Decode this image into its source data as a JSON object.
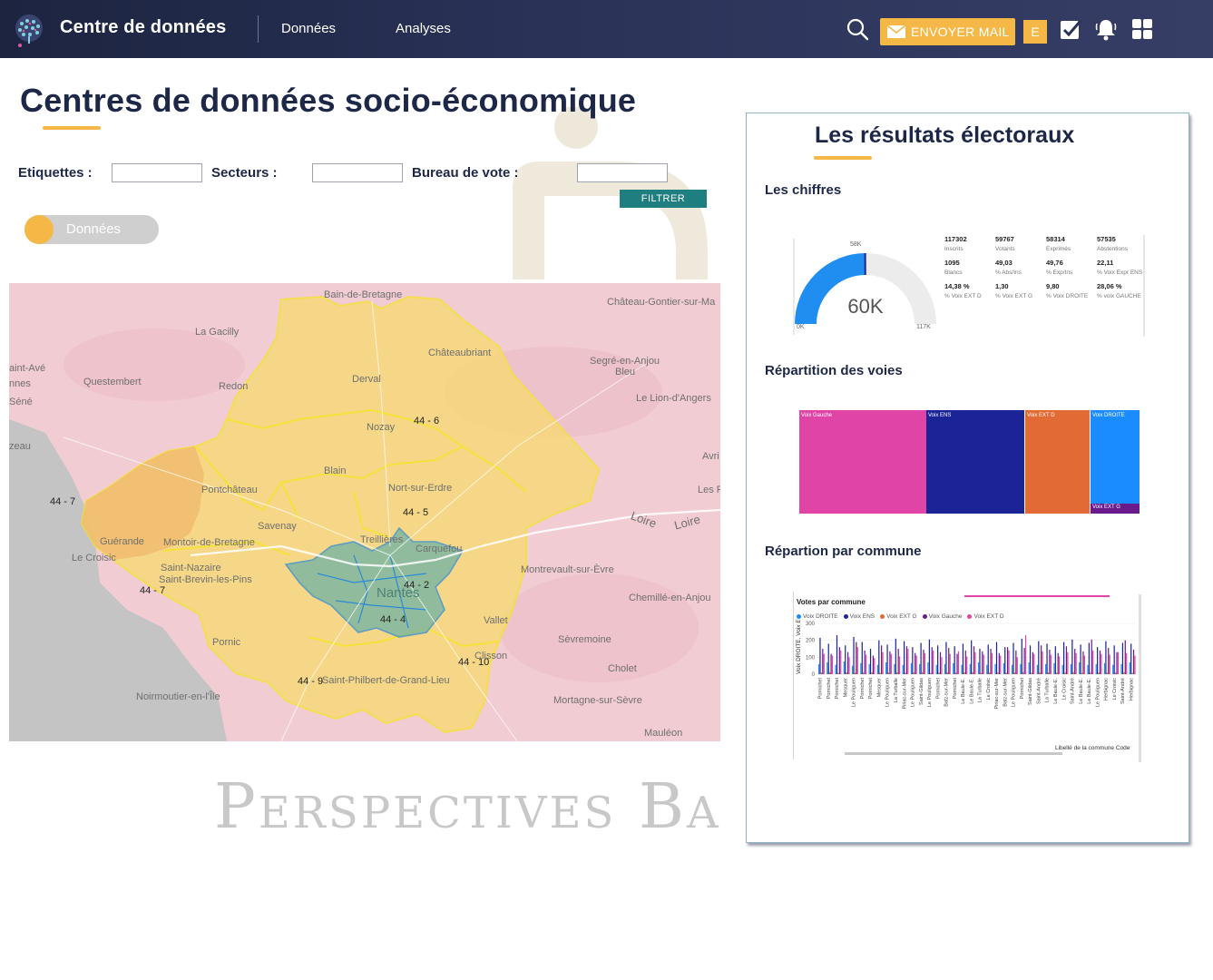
{
  "header": {
    "brand": "Centre de données",
    "nav": [
      "Données",
      "Analyses"
    ],
    "mail_label": "ENVOYER  MAIL",
    "badge": "E"
  },
  "page": {
    "title": "Centres de données socio-économique",
    "watermark": "Perspectives Ba"
  },
  "filters": {
    "labels": [
      "Etiquettes :",
      "Secteurs :",
      "Bureau de vote :"
    ],
    "button": "FILTRER"
  },
  "toggle": {
    "label": "Données"
  },
  "map": {
    "places": [
      "Bain-de-Bretagne",
      "Château-Gontier-sur-Ma",
      "La Gacilly",
      "Châteaubriant",
      "Segré-en-Anjou",
      "Bleu",
      "aint-Avé",
      "nnes",
      "Questembert",
      "Redon",
      "Derval",
      "Le Lion-d'Angers",
      "Séné",
      "Nozay",
      "zeau",
      "Avri",
      "Blain",
      "Pontchâteau",
      "Nort-sur-Erdre",
      "Les P",
      "Loire",
      "Loire",
      "Savenay",
      "Guérande",
      "Montoir-de-Bretagne",
      "Le Croisic",
      "Treillières",
      "Carquefou",
      "Saint-Nazaire",
      "Saint-Brevin-les-Pins",
      "Montrevault-sur-Èvre",
      "Nantes",
      "Chemillé-en-Anjou",
      "Vallet",
      "Pornic",
      "Sèvremoine",
      "Clisson",
      "Cholet",
      "Saint-Philbert-de-Grand-Lieu",
      "Noirmoutier-en-l'Île",
      "Mortagne-sur-Sèvre",
      "Mauléon"
    ],
    "codes": [
      "44 - 6",
      "44 - 7",
      "44 - 5",
      "44 - 7",
      "44 - 2",
      "44 - 4",
      "44 - 10",
      "44 - 9"
    ]
  },
  "panel": {
    "title": "Les résultats électoraux",
    "sections": [
      "Les chiffres",
      "Répartition des voies",
      "Répartion par commune"
    ],
    "gauge": {
      "value": 58314,
      "min": 0,
      "max": 117000,
      "display": "60K",
      "min_label": "0K",
      "max_label": "117K",
      "target_label": "58K"
    },
    "stats": [
      {
        "value": "117302",
        "label": "Inscrits"
      },
      {
        "value": "59767",
        "label": "Votants"
      },
      {
        "value": "58314",
        "label": "Exprimés"
      },
      {
        "value": "57535",
        "label": "Abstentions"
      },
      {
        "value": "1095",
        "label": "Blancs"
      },
      {
        "value": "49,03",
        "label": "% Abs/Ins"
      },
      {
        "value": "49,76",
        "label": "% Exp/Ins"
      },
      {
        "value": "22,11",
        "label": "% Voix Expr ENS"
      },
      {
        "value": "14,38 %",
        "label": "% Voix EXT D"
      },
      {
        "value": "1,30",
        "label": "% Voix EXT G"
      },
      {
        "value": "9,80",
        "label": "% Voix DROITE"
      },
      {
        "value": "28,06 %",
        "label": "% voix GAUCHE"
      }
    ],
    "treemap": [
      {
        "label": "Voix Gauche",
        "color": "#e044a6"
      },
      {
        "label": "Voix ENS",
        "color": "#1a2496"
      },
      {
        "label": "Voix EXT D",
        "color": "#e26b35"
      },
      {
        "label": "Voix DROITE",
        "color": "#1a8cff"
      },
      {
        "label": "Voix EXT G",
        "color": "#6b1a8c"
      }
    ]
  },
  "chart_data": {
    "type": "bar",
    "title": "Votes par commune",
    "ylabel": "Voix DROITE, Voix ENS...",
    "xlabel": "Libellé de la commune Code",
    "ylim": [
      0,
      300
    ],
    "yticks": [
      0,
      100,
      200,
      300
    ],
    "series_colors": [
      "#1a8cff",
      "#1a2496",
      "#e26b35",
      "#6b1a8c",
      "#e044a6"
    ],
    "series": [
      {
        "name": "Voix DROITE",
        "values": [
          60,
          70,
          55,
          75,
          50,
          65,
          60,
          55,
          70,
          60,
          55,
          65,
          60,
          70,
          55,
          60,
          65,
          55,
          60,
          70,
          55,
          60,
          65,
          55,
          60,
          70,
          55,
          60,
          65,
          55,
          60,
          70,
          55,
          60,
          65,
          55,
          60,
          70
        ]
      },
      {
        "name": "Voix ENS",
        "values": [
          215,
          180,
          230,
          170,
          220,
          190,
          150,
          200,
          175,
          210,
          195,
          160,
          185,
          205,
          170,
          190,
          165,
          180,
          200,
          150,
          175,
          190,
          160,
          185,
          210,
          170,
          195,
          180,
          165,
          190,
          205,
          175,
          185,
          160,
          195,
          170,
          185,
          180
        ]
      },
      {
        "name": "Voix EXT G",
        "values": [
          10,
          12,
          8,
          11,
          9,
          10,
          12,
          8,
          10,
          11,
          9,
          10,
          12,
          8,
          10,
          11,
          9,
          10,
          12,
          8,
          10,
          11,
          9,
          10,
          12,
          8,
          10,
          11,
          9,
          10,
          12,
          8,
          10,
          11,
          9,
          10,
          12,
          8
        ]
      },
      {
        "name": "Voix Gauche",
        "values": [
          150,
          120,
          160,
          130,
          190,
          140,
          110,
          170,
          135,
          150,
          165,
          125,
          145,
          160,
          130,
          155,
          120,
          140,
          165,
          135,
          150,
          125,
          160,
          140,
          155,
          130,
          170,
          145,
          125,
          165,
          150,
          135,
          205,
          140,
          155,
          130,
          200,
          145
        ]
      },
      {
        "name": "Voix EXT D",
        "values": [
          120,
          110,
          140,
          100,
          160,
          115,
          95,
          130,
          120,
          105,
          150,
          110,
          125,
          140,
          100,
          120,
          135,
          105,
          130,
          115,
          125,
          110,
          140,
          100,
          230,
          120,
          135,
          115,
          105,
          130,
          125,
          110,
          140,
          120,
          115,
          130,
          125,
          110
        ]
      }
    ],
    "categories": [
      "Pornichet",
      "Pornichet",
      "Pornichet",
      "Mesquer",
      "Le Pouliguen",
      "Pornichet",
      "Pornichet",
      "Mesquer",
      "Le Pouliguen",
      "La Turballe",
      "Piriac-sur-Mer",
      "Le Pouliguen",
      "Saint-Gildas",
      "Le Pouliguen",
      "Pornichet",
      "Batz-sur-Mer",
      "Pornichet",
      "Le Baule-E.",
      "Le Baule-E.",
      "La Turballe",
      "Le Croisic",
      "Piriac-sur-Mer",
      "Batz-sur-Mer",
      "Le Pouliguen",
      "Pornichet",
      "Saint-Gildas",
      "Saint-André",
      "La Turballe",
      "Le Baule-E.",
      "Le Croisic",
      "Saint-André",
      "Le Baule-E.",
      "Le Baule-E.",
      "Le Pouliguen",
      "Herbignac",
      "Le Croisic",
      "Saint-André",
      "Herbignac"
    ]
  }
}
